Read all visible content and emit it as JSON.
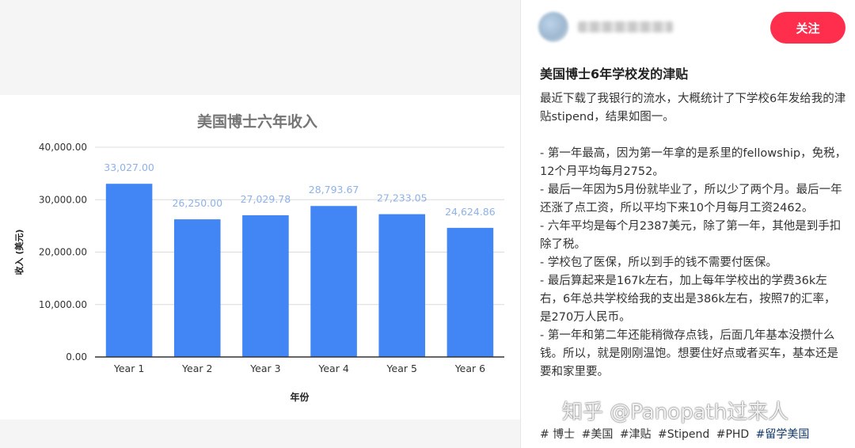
{
  "chart_data": {
    "type": "bar",
    "title": "美国博士六年收入",
    "xlabel": "年份",
    "ylabel": "收入 (美元)",
    "categories": [
      "Year 1",
      "Year 2",
      "Year 3",
      "Year 4",
      "Year 5",
      "Year 6"
    ],
    "values": [
      33027.0,
      26250.0,
      27029.78,
      28793.67,
      27233.05,
      24624.86
    ],
    "value_labels": [
      "33,027.00",
      "26,250.00",
      "27,029.78",
      "28,793.67",
      "27,233.05",
      "24,624.86"
    ],
    "yticks": [
      "0.00",
      "10,000.00",
      "20,000.00",
      "30,000.00",
      "40,000.00"
    ],
    "ylim": [
      0,
      40000
    ],
    "grid": true,
    "bar_color": "#4285f4",
    "label_color": "#8fb1e8"
  },
  "post": {
    "follow_label": "关注",
    "title": "美国博士6年学校发的津贴",
    "paragraphs": [
      "最近下载了我银行的流水，大概统计了下学校6年发给我的津贴stipend，结果如图一。",
      "",
      "- 第一年最高，因为第一年拿的是系里的fellowship，免税，12个月平均每月2752。",
      "- 最后一年因为5月份就毕业了，所以少了两个月。最后一年还涨了点工资，所以平均下来10个月每月工资2462。",
      "- 六年平均是每个月2387美元，除了第一年，其他是到手扣除了税。",
      "- 学校包了医保，所以到手的钱不需要付医保。",
      "- 最后算起来是167k左右，加上每年学校出的学费36k左右，6年总共学校给我的支出是386k左右，按照7的汇率，是270万人民币。",
      "- 第一年和第二年还能稍微存点钱，后面几年基本没攒什么钱。所以，就是刚刚温饱。想要住好点或者买车，基本还是要和家里要。"
    ],
    "tags": [
      "# 博士",
      "#美国",
      "#津贴",
      "#Stipend",
      "#PHD"
    ],
    "tag_highlight": "#留学美国",
    "accent": "#ff2e4d"
  },
  "watermark": "知乎 @Panopath过来人"
}
